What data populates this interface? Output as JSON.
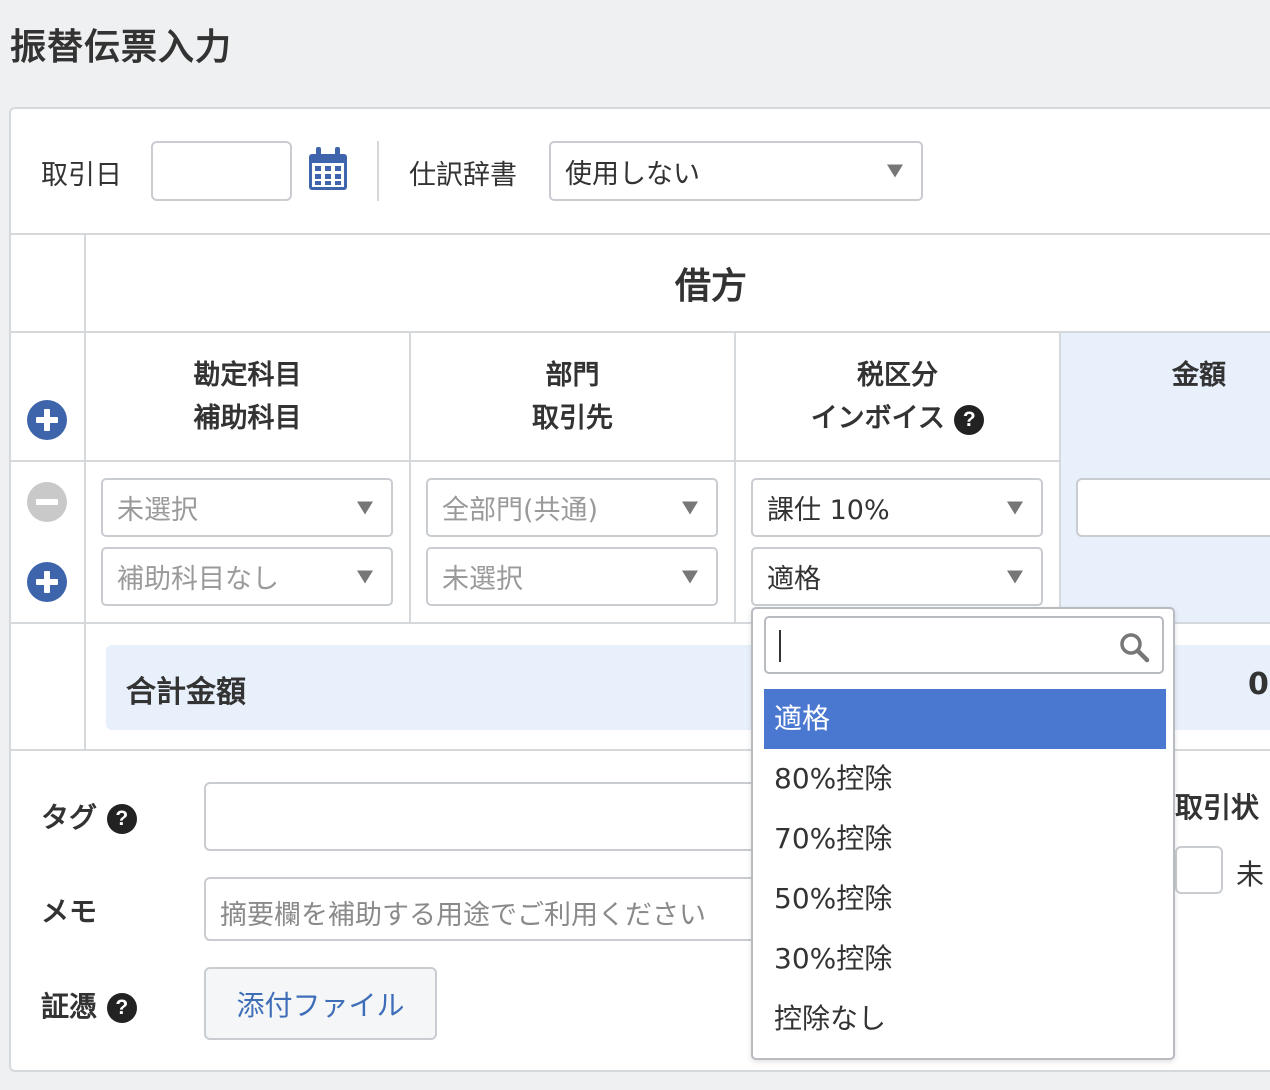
{
  "page": {
    "title": "振替伝票入力"
  },
  "header": {
    "date_label": "取引日",
    "date_value": "",
    "dictionary_label": "仕訳辞書",
    "dictionary_value": "使用しない"
  },
  "table": {
    "side_title": "借方",
    "col_account": "勘定科目",
    "col_sub_account": "補助科目",
    "col_department": "部門",
    "col_partner": "取引先",
    "col_tax": "税区分",
    "col_invoice": "インボイス",
    "col_amount": "金額",
    "row": {
      "account": "未選択",
      "sub_account": "補助科目なし",
      "department": "全部門(共通)",
      "partner": "未選択",
      "tax": "課仕 10%",
      "invoice": "適格",
      "amount": ""
    },
    "total_label": "合計金額",
    "total_value_partial": "0"
  },
  "dropdown": {
    "search_value": "",
    "options": [
      "適格",
      "80%控除",
      "70%控除",
      "50%控除",
      "30%控除",
      "控除なし"
    ],
    "selected": "適格"
  },
  "footer": {
    "tag_label": "タグ",
    "memo_label": "メモ",
    "memo_placeholder": "摘要欄を補助する用途でご利用ください",
    "evidence_label": "証憑",
    "attach_button": "添付ファイル",
    "status_label_partial": "取引状",
    "status_option_partial": "未"
  },
  "colors": {
    "accent": "#3e65ac",
    "selected_option": "#4a77d0",
    "amount_column_bg": "#e8f0fc",
    "link_text": "#3f6eb8"
  }
}
